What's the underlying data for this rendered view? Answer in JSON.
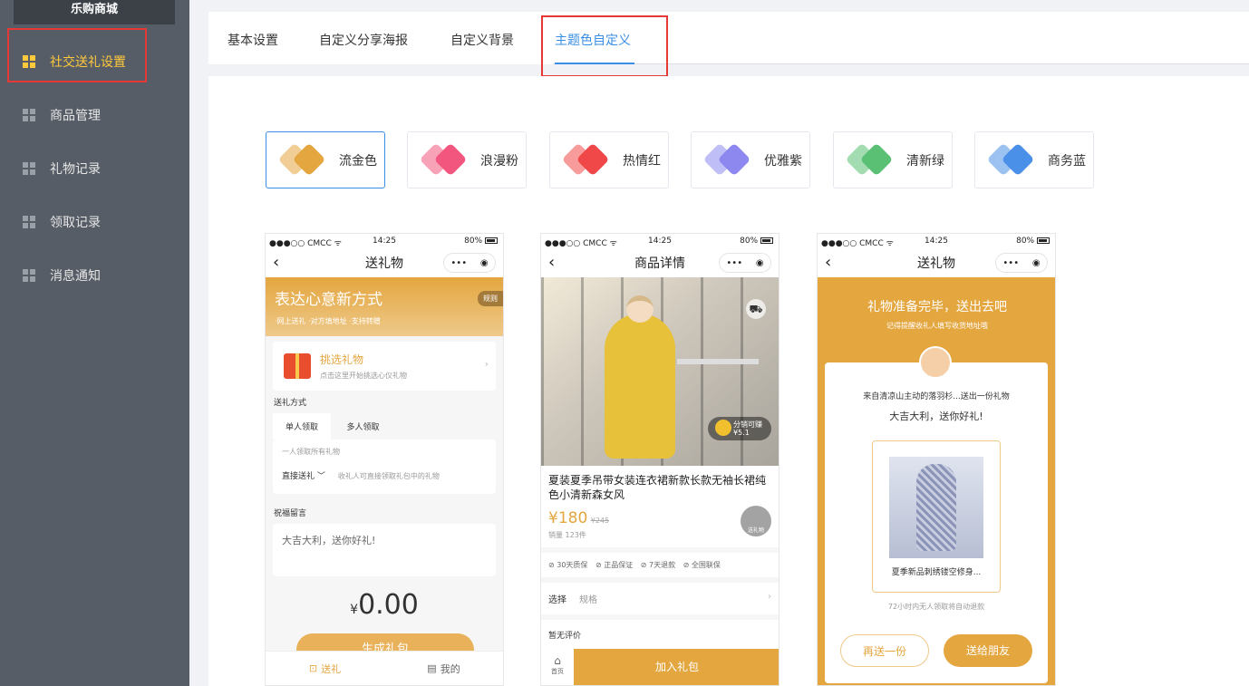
{
  "sidebar": {
    "brand": "乐购商城",
    "items": [
      {
        "label": "社交送礼设置",
        "active": true
      },
      {
        "label": "商品管理"
      },
      {
        "label": "礼物记录"
      },
      {
        "label": "领取记录"
      },
      {
        "label": "消息通知"
      }
    ]
  },
  "tabs": [
    "基本设置",
    "自定义分享海报",
    "自定义背景",
    "主题色自定义"
  ],
  "active_tab": "主题色自定义",
  "themes": [
    {
      "name": "流金色",
      "color": "#e4a63f",
      "selected": true
    },
    {
      "name": "浪漫粉",
      "color": "#f2557e"
    },
    {
      "name": "热情红",
      "color": "#f04848"
    },
    {
      "name": "优雅紫",
      "color": "#8d88ef"
    },
    {
      "name": "清新绿",
      "color": "#5ac073"
    },
    {
      "name": "商务蓝",
      "color": "#4a8fe8"
    }
  ],
  "phone_status": {
    "carrier": "●●●○○ CMCC ᯤ",
    "time": "14:25",
    "battery": "80%"
  },
  "preview1": {
    "nav_title": "送礼物",
    "hero_title": "表达心意新方式",
    "hero_sub": "·网上送礼   ·对方填地址   ·支持转赠",
    "rule": "规则",
    "pick_title": "挑选礼物",
    "pick_sub": "点击这里开始挑选心仪礼物",
    "method_label": "送礼方式",
    "tab_single": "单人领取",
    "tab_multi": "多人领取",
    "single_desc": "一人领取所有礼物",
    "direct": "直接送礼 ﹀",
    "direct_desc": "收礼人可直接领取礼包中的礼物",
    "wish_label": "祝福留言",
    "wish_text": "大吉大利，送你好礼!",
    "currency": "¥",
    "amount": "0.00",
    "button": "生成礼包",
    "tab_send": "送礼",
    "tab_mine": "我的"
  },
  "preview2": {
    "nav_title": "商品详情",
    "share_label": "分销可赚",
    "share_amount": "¥5.1",
    "product_title": "夏装夏季吊带女装连衣裙新款长款无袖长裙纯色小清新森女风",
    "price": "¥180",
    "old_price": "¥245",
    "sales": "销量 123件",
    "gift_label": "送礼物",
    "services": [
      "30天质保",
      "正品保证",
      "7天退款",
      "全国联保"
    ],
    "select_label": "选择",
    "select_value": "规格",
    "review": "暂无评价",
    "home": "首页",
    "add": "加入礼包"
  },
  "preview3": {
    "nav_title": "送礼物",
    "headline": "礼物准备完毕，送出去吧",
    "subline": "记得提醒收礼人填写收货地址哦",
    "from": "来自清凉山主动的落羽杉...送出一份礼物",
    "wish": "大吉大利，送你好礼!",
    "product": "夏季新品刺绣镂空修身...",
    "note": "72小时内无人领取将自动退款",
    "again": "再送一份",
    "send": "送给朋友"
  }
}
